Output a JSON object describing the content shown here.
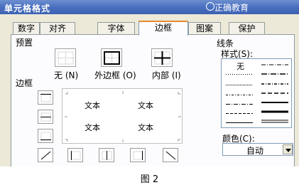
{
  "window": {
    "title": "单元格格式",
    "watermark": "正确教育"
  },
  "tabs": [
    {
      "label": "数字"
    },
    {
      "label": "对齐"
    },
    {
      "label": "字体"
    },
    {
      "label": "边框",
      "active": true
    },
    {
      "label": "图案"
    },
    {
      "label": "保护"
    }
  ],
  "presets": {
    "section_label": "预置",
    "none_label": "无 (N)",
    "outline_label": "外边框 (O)",
    "inside_label": "内部 (I)"
  },
  "border": {
    "section_label": "边框",
    "preview_cells": [
      "文本",
      "文本",
      "文本",
      "文本"
    ]
  },
  "line": {
    "section_label": "线条",
    "style_label": "样式(S):",
    "none_option": "无"
  },
  "color": {
    "label": "颜色(C):",
    "value": "自动"
  },
  "caption": "图 2"
}
